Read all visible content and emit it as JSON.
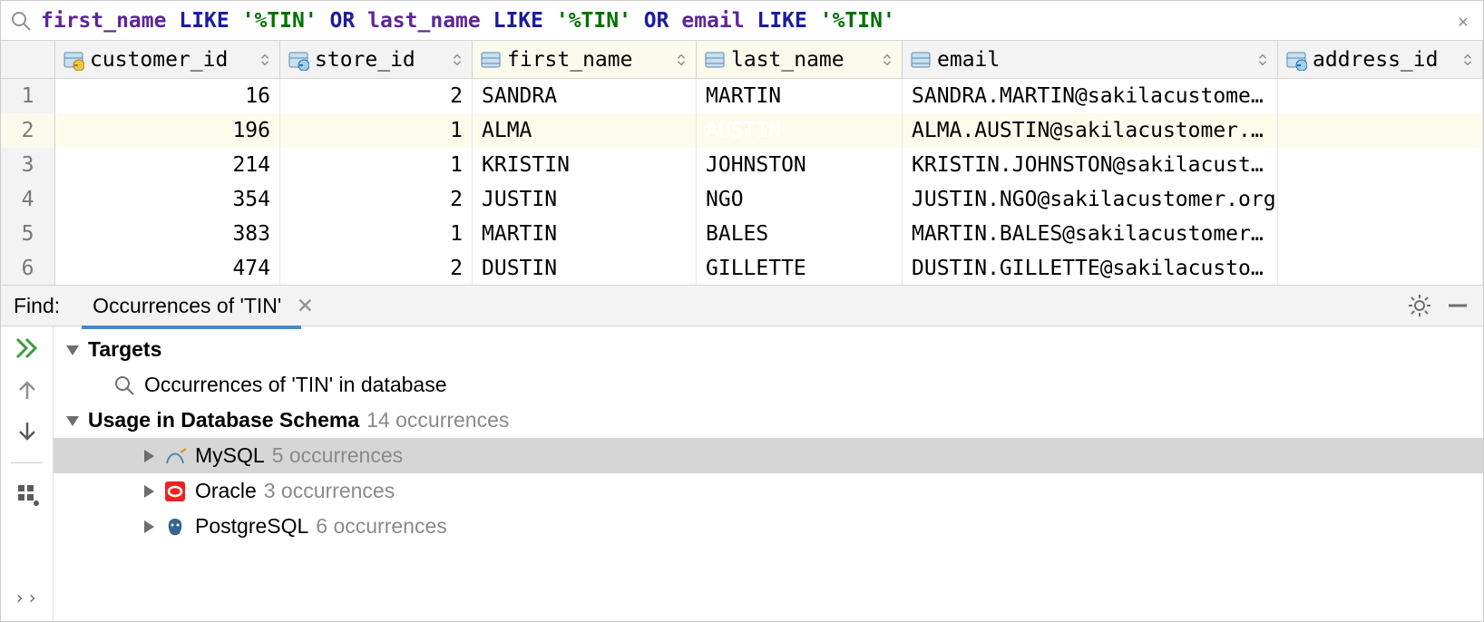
{
  "filter": {
    "tokens": [
      {
        "t": "first_name",
        "c": "ident"
      },
      {
        "t": " ",
        "c": ""
      },
      {
        "t": "LIKE",
        "c": "kw"
      },
      {
        "t": " ",
        "c": ""
      },
      {
        "t": "'%TIN'",
        "c": "str"
      },
      {
        "t": " ",
        "c": ""
      },
      {
        "t": "OR",
        "c": "kw"
      },
      {
        "t": " ",
        "c": ""
      },
      {
        "t": "last_name",
        "c": "ident"
      },
      {
        "t": " ",
        "c": ""
      },
      {
        "t": "LIKE",
        "c": "kw"
      },
      {
        "t": " ",
        "c": ""
      },
      {
        "t": "'%TIN'",
        "c": "str"
      },
      {
        "t": " ",
        "c": ""
      },
      {
        "t": "OR",
        "c": "kw"
      },
      {
        "t": " ",
        "c": ""
      },
      {
        "t": "email",
        "c": "ident"
      },
      {
        "t": " ",
        "c": ""
      },
      {
        "t": "LIKE",
        "c": "kw"
      },
      {
        "t": " ",
        "c": ""
      },
      {
        "t": "'%TIN'",
        "c": "str"
      }
    ]
  },
  "columns": [
    {
      "name": "customer_id",
      "icon": "pk",
      "highlight": false
    },
    {
      "name": "store_id",
      "icon": "fk",
      "highlight": false
    },
    {
      "name": "first_name",
      "icon": "col",
      "highlight": true
    },
    {
      "name": "last_name",
      "icon": "col",
      "highlight": true
    },
    {
      "name": "email",
      "icon": "col",
      "highlight": false
    },
    {
      "name": "address_id",
      "icon": "fk",
      "highlight": false
    }
  ],
  "rows": [
    {
      "n": "1",
      "customer_id": "16",
      "store_id": "2",
      "first_name": "SANDRA",
      "last_name": "MARTIN",
      "email": "SANDRA.MARTIN@sakilacustome…"
    },
    {
      "n": "2",
      "customer_id": "196",
      "store_id": "1",
      "first_name": "ALMA",
      "last_name": "AUSTIN",
      "email": "ALMA.AUSTIN@sakilacustomer.…",
      "highlight": true,
      "selected_col": "last_name"
    },
    {
      "n": "3",
      "customer_id": "214",
      "store_id": "1",
      "first_name": "KRISTIN",
      "last_name": "JOHNSTON",
      "email": "KRISTIN.JOHNSTON@sakilacust…"
    },
    {
      "n": "4",
      "customer_id": "354",
      "store_id": "2",
      "first_name": "JUSTIN",
      "last_name": "NGO",
      "email": "JUSTIN.NGO@sakilacustomer.org"
    },
    {
      "n": "5",
      "customer_id": "383",
      "store_id": "1",
      "first_name": "MARTIN",
      "last_name": "BALES",
      "email": "MARTIN.BALES@sakilacustomer…"
    },
    {
      "n": "6",
      "customer_id": "474",
      "store_id": "2",
      "first_name": "DUSTIN",
      "last_name": "GILLETTE",
      "email": "DUSTIN.GILLETTE@sakilacusto…"
    }
  ],
  "find": {
    "label": "Find:",
    "tab_label": "Occurrences of 'TIN'",
    "tree": {
      "targets_label": "Targets",
      "targets_sub": "Occurrences of 'TIN' in database",
      "usage_label": "Usage in Database Schema",
      "usage_count": "14 occurrences",
      "items": [
        {
          "db": "MySQL",
          "count": "5 occurrences",
          "icon": "mysql",
          "selected": true
        },
        {
          "db": "Oracle",
          "count": "3 occurrences",
          "icon": "oracle"
        },
        {
          "db": "PostgreSQL",
          "count": "6 occurrences",
          "icon": "postgres"
        }
      ]
    }
  }
}
